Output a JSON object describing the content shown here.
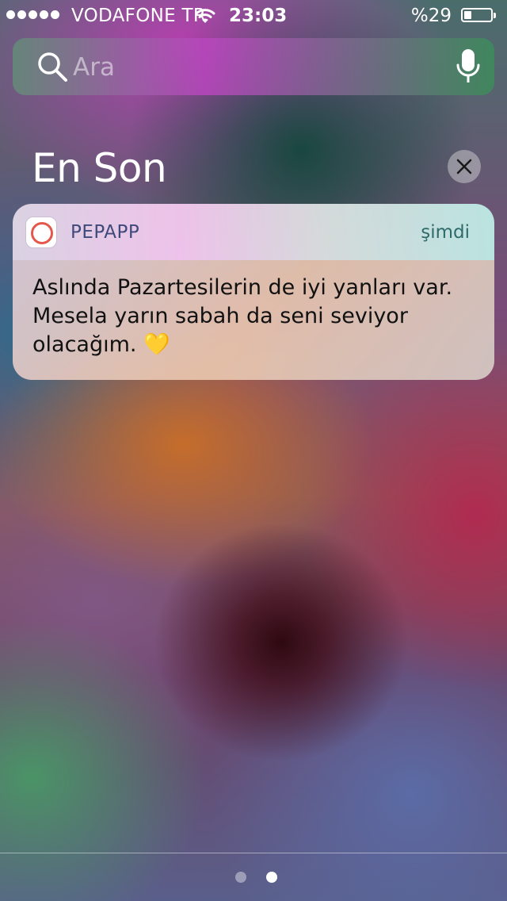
{
  "status_bar": {
    "carrier": "VODAFONE TR",
    "time": "23:03",
    "battery_percent": "%29",
    "battery_level": 0.29,
    "signal_dots": 5
  },
  "search": {
    "placeholder": "Ara",
    "value": ""
  },
  "section": {
    "title": "En Son"
  },
  "notification": {
    "app_name": "PEPAPP",
    "time": "şimdi",
    "message": "Aslında Pazartesilerin de iyi yanları var. Mesela yarın sabah da seni seviyor olacağım. 💛"
  },
  "pages": {
    "count": 2,
    "current": 2
  }
}
